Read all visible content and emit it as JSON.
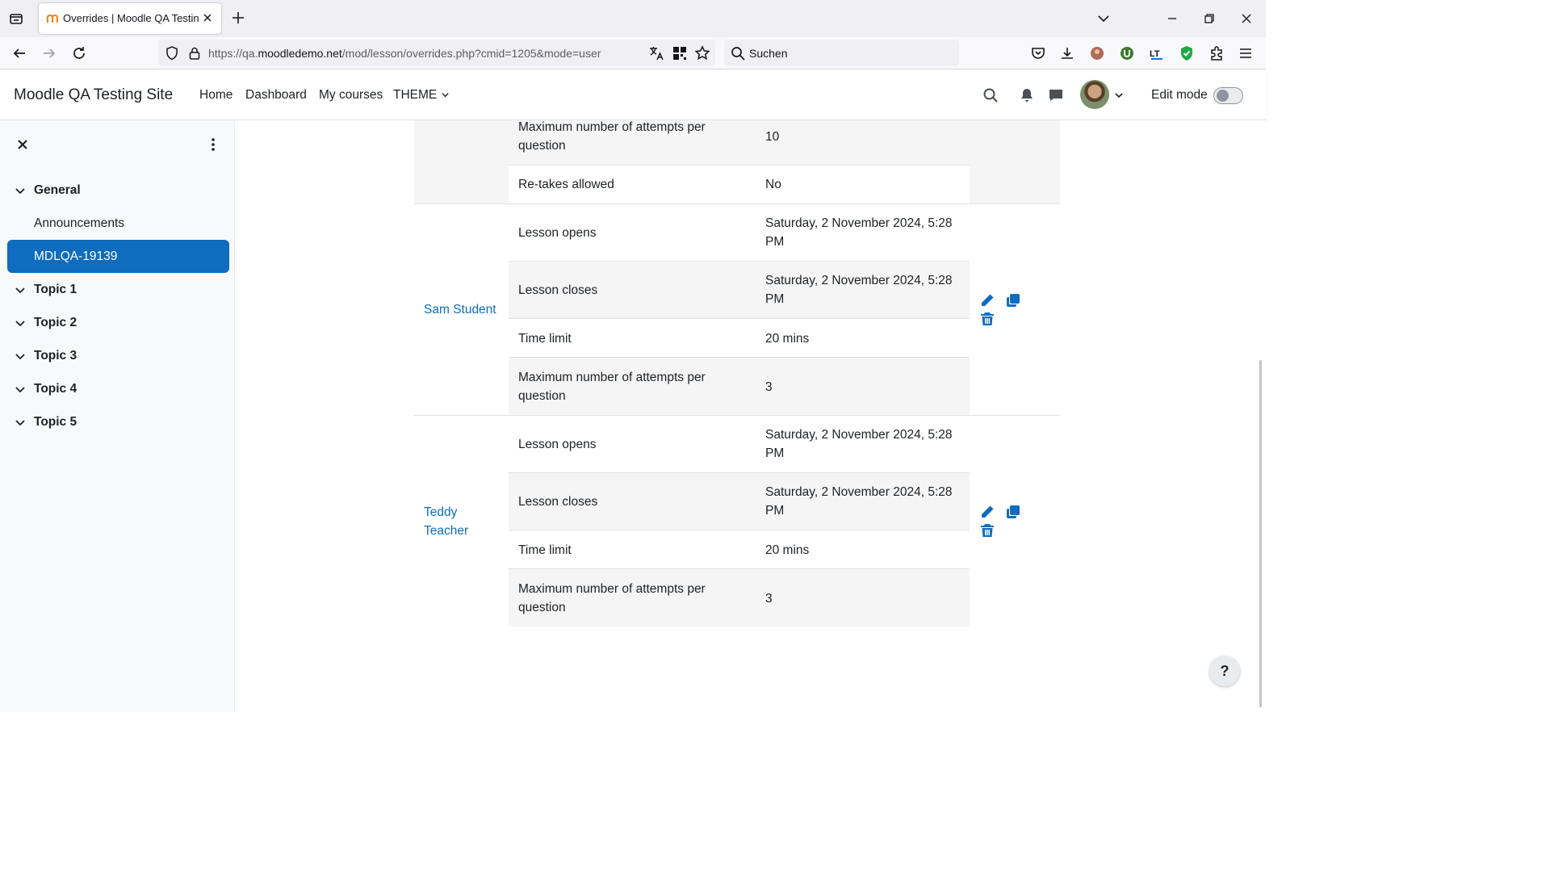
{
  "browser": {
    "tab_title": "Overrides | Moodle QA Testing",
    "url_prefix": "https://qa.",
    "url_domain": "moodledemo.net",
    "url_path": "/mod/lesson/overrides.php?cmid=1205&mode=user",
    "search_placeholder": "Suchen"
  },
  "header": {
    "site_name": "Moodle QA Testing Site",
    "menu": [
      "Home",
      "Dashboard",
      "My courses",
      "THEME"
    ],
    "edit_mode_label": "Edit mode"
  },
  "drawer": {
    "sections": [
      "General",
      "Topic 1",
      "Topic 2",
      "Topic 3",
      "Topic 4",
      "Topic 5"
    ],
    "activities": [
      "Announcements",
      "MDLQA-19139"
    ],
    "active_activity": "MDLQA-19139"
  },
  "overrides": {
    "prev_rows": [
      {
        "setting": "Maximum number of attempts per question",
        "value": "10"
      },
      {
        "setting": "Re-takes allowed",
        "value": "No"
      }
    ],
    "users": [
      {
        "name": "Sam Student",
        "rows": [
          {
            "setting": "Lesson opens",
            "value": "Saturday, 2 November 2024, 5:28 PM"
          },
          {
            "setting": "Lesson closes",
            "value": "Saturday, 2 November 2024, 5:28 PM"
          },
          {
            "setting": "Time limit",
            "value": "20 mins"
          },
          {
            "setting": "Maximum number of attempts per question",
            "value": "3"
          }
        ]
      },
      {
        "name": "Teddy Teacher",
        "rows": [
          {
            "setting": "Lesson opens",
            "value": "Saturday, 2 November 2024, 5:28 PM"
          },
          {
            "setting": "Lesson closes",
            "value": "Saturday, 2 November 2024, 5:28 PM"
          },
          {
            "setting": "Time limit",
            "value": "20 mins"
          },
          {
            "setting": "Maximum number of attempts per question",
            "value": "3"
          }
        ]
      }
    ]
  },
  "help_label": "?",
  "colors": {
    "primary": "#0f6cbf",
    "striped_row": "#f5f5f5"
  },
  "icons": [
    "edit-icon",
    "copy-icon",
    "delete-icon"
  ]
}
